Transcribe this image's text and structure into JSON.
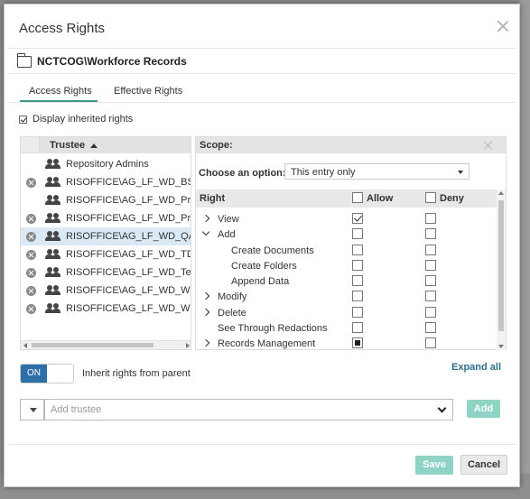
{
  "dialog": {
    "title": "Access Rights",
    "path": "NCTCOG\\Workforce Records",
    "tabs": [
      {
        "label": "Access Rights",
        "active": true
      },
      {
        "label": "Effective Rights",
        "active": false
      }
    ],
    "display_inherited_label": "Display inherited rights",
    "display_inherited_checked": true
  },
  "trustees": {
    "column_header": "Trustee",
    "rows": [
      {
        "name": "Repository Admins",
        "removable": false,
        "selected": false
      },
      {
        "name": "RISOFFICE\\AG_LF_WD_BSC_VI",
        "removable": true,
        "selected": false
      },
      {
        "name": "RISOFFICE\\AG_LF_WD_Proces",
        "removable": false,
        "selected": false
      },
      {
        "name": "RISOFFICE\\AG_LF_WD_Proces",
        "removable": true,
        "selected": false
      },
      {
        "name": "RISOFFICE\\AG_LF_WD_QA_MC",
        "removable": true,
        "selected": true
      },
      {
        "name": "RISOFFICE\\AG_LF_WD_TDS_VI",
        "removable": true,
        "selected": false
      },
      {
        "name": "RISOFFICE\\AG_LF_WD_Test_Vi",
        "removable": true,
        "selected": false
      },
      {
        "name": "RISOFFICE\\AG_LF_WD_WF_Sta",
        "removable": true,
        "selected": false
      },
      {
        "name": "RISOFFICE\\AG_LF_WD_WFSUP",
        "removable": true,
        "selected": false
      }
    ]
  },
  "scope": {
    "header": "Scope:",
    "choose_label": "Choose an option:",
    "selected_option": "This entry only",
    "columns": {
      "right": "Right",
      "allow": "Allow",
      "deny": "Deny"
    },
    "rights": [
      {
        "label": "View",
        "level": 0,
        "expander": "right",
        "allow": "checked",
        "deny": "empty"
      },
      {
        "label": "Add",
        "level": 0,
        "expander": "down",
        "allow": "empty",
        "deny": "empty"
      },
      {
        "label": "Create Documents",
        "level": 1,
        "expander": "none",
        "allow": "empty",
        "deny": "empty"
      },
      {
        "label": "Create Folders",
        "level": 1,
        "expander": "none",
        "allow": "empty",
        "deny": "empty"
      },
      {
        "label": "Append Data",
        "level": 1,
        "expander": "none",
        "allow": "empty",
        "deny": "empty"
      },
      {
        "label": "Modify",
        "level": 0,
        "expander": "right",
        "allow": "empty",
        "deny": "empty"
      },
      {
        "label": "Delete",
        "level": 0,
        "expander": "right",
        "allow": "empty",
        "deny": "empty"
      },
      {
        "label": "See Through Redactions",
        "level": 0,
        "expander": "none",
        "allow": "empty",
        "deny": "empty"
      },
      {
        "label": "Records Management",
        "level": 0,
        "expander": "right",
        "allow": "partial",
        "deny": "empty"
      }
    ]
  },
  "inherit": {
    "toggle_label": "ON",
    "label": "Inherit rights from parent"
  },
  "expand_all": "Expand all",
  "add_trustee": {
    "placeholder": "Add trustee",
    "button": "Add"
  },
  "footer": {
    "save": "Save",
    "cancel": "Cancel"
  },
  "colors": {
    "accent": "#3a9a8c",
    "primary_button": "#8fd3c4",
    "toggle_on": "#2f6fa8",
    "selection": "#dbe9f5"
  }
}
